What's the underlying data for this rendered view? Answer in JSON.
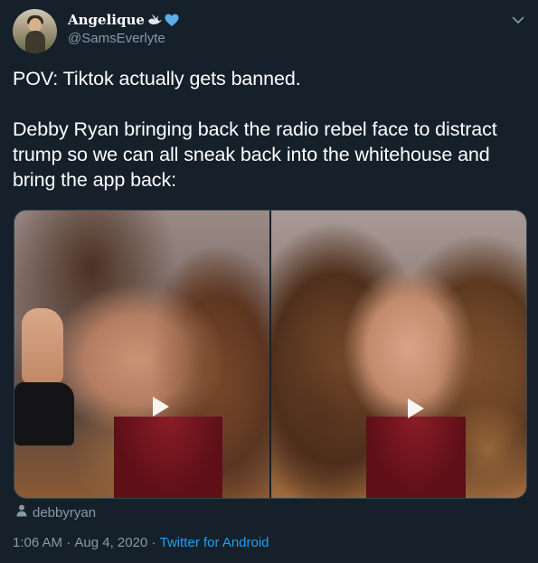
{
  "tweet": {
    "author": {
      "display_name": "Angelique",
      "name_emoji_icons": [
        "dove-icon",
        "blue-heart-icon"
      ],
      "handle": "@SamsEverlyte"
    },
    "menu_icon": "chevron-down-icon",
    "text": "POV: Tiktok actually gets banned.\n\nDebby Ryan bringing back the radio rebel face to distract trump so we can all sneak back into the whitehouse and bring the app back:",
    "media": {
      "items": [
        {
          "type": "video",
          "icon": "play-icon"
        },
        {
          "type": "video",
          "icon": "play-icon"
        }
      ]
    },
    "attribution": {
      "icon": "user-icon",
      "username": "debbyryan"
    },
    "meta": {
      "time": "1:06 AM",
      "separator1": " · ",
      "date": "Aug 4, 2020",
      "separator2": " · ",
      "source": "Twitter for Android"
    }
  },
  "colors": {
    "background": "#15202b",
    "text_primary": "#ffffff",
    "text_secondary": "#8899a6",
    "accent": "#1da1f2",
    "border": "#38444d"
  }
}
